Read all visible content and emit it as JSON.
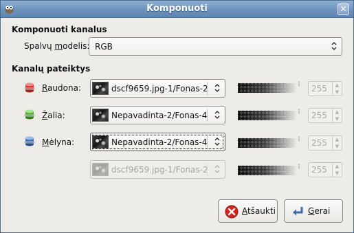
{
  "window": {
    "title": "Komponuoti",
    "close_glyph": "✕",
    "app_icon": "gimp-wilber-icon"
  },
  "compose": {
    "section_title": "Komponuoti kanalus",
    "color_model_label_pre": "Spalvų ",
    "color_model_label_mnemonic": "m",
    "color_model_label_post": "odelis:",
    "color_model_value": "RGB"
  },
  "sources": {
    "section_title": "Kanalų pateiktys",
    "channels": [
      {
        "mnemonic": "R",
        "label_rest": "audona:",
        "source": "dscf9659.jpg-1/Fonas-2",
        "value": "255",
        "icon_color": "#d9302c"
      },
      {
        "mnemonic": "Ž",
        "label_rest": "alia:",
        "source": "Nepavadinta-2/Fonas-4",
        "value": "255",
        "icon_color": "#4caf2e"
      },
      {
        "mnemonic": "M",
        "label_rest": "ėlyna:",
        "source": "Nepavadinta-2/Fonas-4",
        "value": "255",
        "icon_color": "#3a6fb8"
      },
      {
        "source": "dscf9659.jpg-1/Fonas-2",
        "value": "255",
        "disabled": true
      }
    ]
  },
  "buttons": {
    "cancel_mnemonic": "A",
    "cancel_rest": "tšaukti",
    "ok_mnemonic": "G",
    "ok_rest": "erai"
  }
}
